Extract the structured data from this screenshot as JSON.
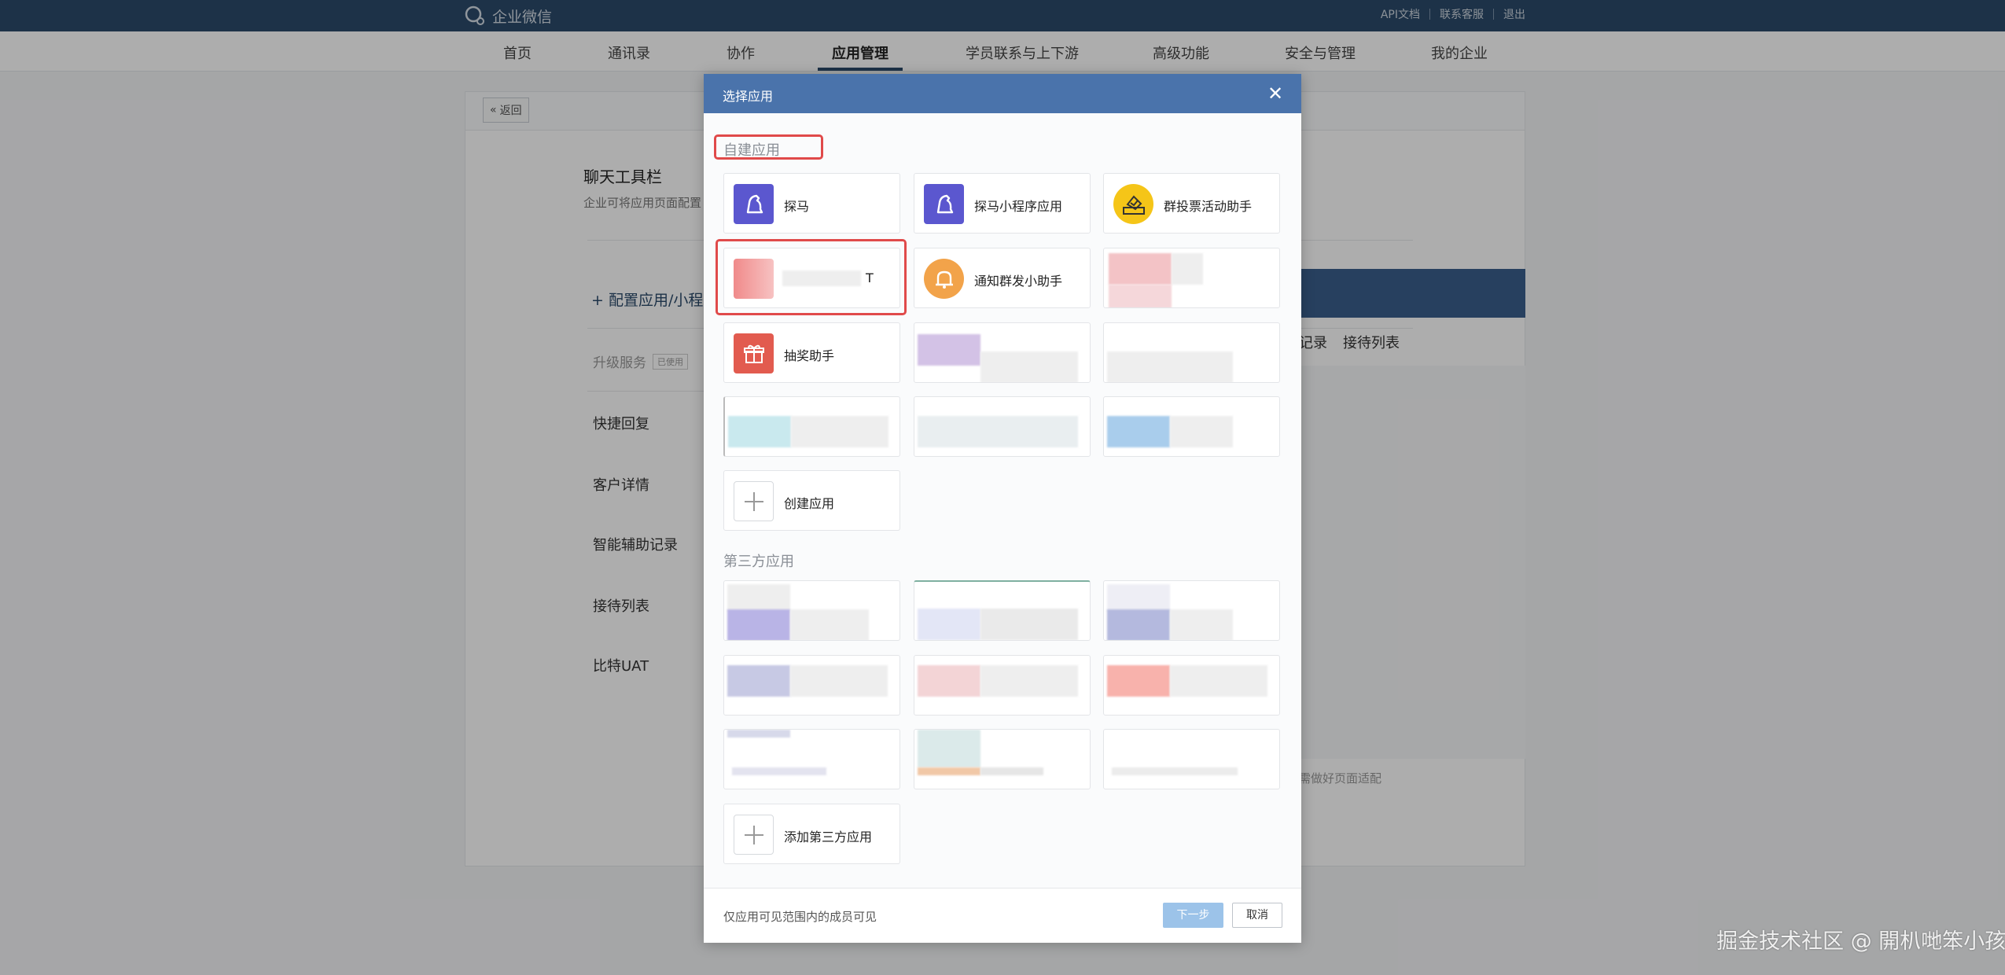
{
  "topbar": {
    "logo_text": "企业微信",
    "links": [
      "API文档",
      "联系客服",
      "退出"
    ]
  },
  "nav": {
    "items": [
      "首页",
      "通讯录",
      "协作",
      "应用管理",
      "学员联系与上下游",
      "高级功能",
      "安全与管理",
      "我的企业"
    ],
    "active": "应用管理"
  },
  "background": {
    "back_label": "返回",
    "title": "聊天工具栏",
    "desc": "企业可将应用页面配置",
    "config_label": "配置应用/小程",
    "upgrade_label": "升级服务",
    "upgrade_tag": "已使用",
    "items": [
      "快捷回复",
      "客户详情",
      "智能辅助记录",
      "接待列表",
      "比特UAT"
    ],
    "right_links": [
      "记录",
      "接待列表"
    ],
    "note": "需做好页面适配"
  },
  "modal": {
    "title": "选择应用",
    "close_icon": "close-icon",
    "self_built_label": "自建应用",
    "third_party_label": "第三方应用",
    "self_built_apps": [
      {
        "name": "探马",
        "icon": "horse-icon",
        "color": "#5b57cf"
      },
      {
        "name": "探马小程序应用",
        "icon": "horse-icon",
        "color": "#5b57cf"
      },
      {
        "name": "群投票活动助手",
        "icon": "vote-icon",
        "color": "#f5c518"
      },
      {
        "name": "T",
        "icon": "blurred-app-icon",
        "color": "#f08a8a"
      },
      {
        "name": "通知群发小助手",
        "icon": "bell-icon",
        "color": "#f2a34a"
      },
      {
        "name": "抽奖助手",
        "icon": "gift-icon",
        "color": "#e25b4f"
      }
    ],
    "create_app_label": "创建应用",
    "add_third_party_label": "添加第三方应用",
    "footer_note": "仅应用可见范围内的成员可见",
    "next_label": "下一步",
    "cancel_label": "取消"
  },
  "watermark": "掘金技术社区 @ 開朳哋笨小孩"
}
